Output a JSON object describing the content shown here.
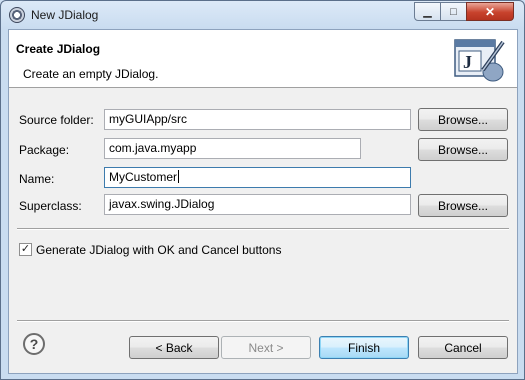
{
  "window": {
    "title": "New JDialog"
  },
  "caption_buttons": {
    "minimize": "▁",
    "maximize": "□",
    "close": "✕"
  },
  "header": {
    "title": "Create JDialog",
    "description": "Create an empty JDialog.",
    "image_letter": "J"
  },
  "form": {
    "source_folder": {
      "label": "Source folder:",
      "value": "myGUIApp/src",
      "browse": "Browse..."
    },
    "package": {
      "label": "Package:",
      "value": "com.java.myapp",
      "browse": "Browse..."
    },
    "name": {
      "label": "Name:",
      "value": "MyCustomer"
    },
    "superclass": {
      "label": "Superclass:",
      "value": "javax.swing.JDialog",
      "browse": "Browse..."
    }
  },
  "option": {
    "label": "Generate JDialog with OK and Cancel buttons",
    "checked": true,
    "check_glyph": "✓"
  },
  "help": {
    "glyph": "?"
  },
  "buttons": {
    "back": "< Back",
    "next": "Next >",
    "finish": "Finish",
    "cancel": "Cancel"
  }
}
